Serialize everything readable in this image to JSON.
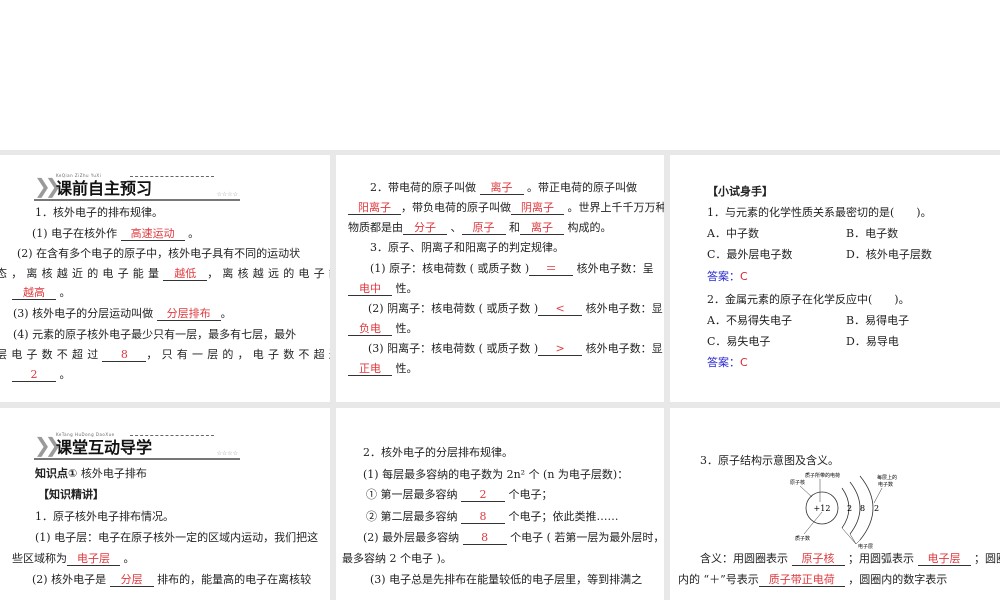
{
  "panels": [
    {
      "header": {
        "pinyin": "KeQian ZiZhu YuXi",
        "title": "课前自主预习",
        "stars": "☆☆☆☆"
      },
      "lines": [
        {
          "segs": [
            "1．核外电子的排布规律。"
          ]
        },
        {
          "segs": [
            "(1) 电子在核外作 ",
            {
              "blank": "高速运动"
            },
            " 。"
          ]
        },
        {
          "segs": [
            "(2) 在含有多个电子的原子中，核外电子具有不同的运动状"
          ]
        },
        {
          "segs": [
            "态，离核越近的电子能量",
            {
              "blank": "越低"
            },
            "，离核越远的电子能量"
          ]
        },
        {
          "segs": [
            {
              "blank": "越高"
            },
            " 。"
          ]
        },
        {
          "segs": [
            "(3) 核外电子的分层运动叫做 ",
            {
              "blank": "分层排布"
            },
            "。"
          ]
        },
        {
          "segs": [
            "(4) 元素的原子核外电子最少只有一层，最多有七层，最外"
          ]
        },
        {
          "segs": [
            "层电子数不超过",
            {
              "blank": "8"
            },
            "，只有一层的，电子数不超过"
          ]
        },
        {
          "segs": [
            {
              "blank": "2"
            },
            " 。"
          ]
        }
      ]
    },
    {
      "lines": [
        {
          "segs": [
            "2．带电荷的原子叫做 ",
            {
              "blank": "离子"
            },
            " 。带正电荷的原子叫做"
          ]
        },
        {
          "segs": [
            {
              "blank": "阳离子"
            },
            "，带负电荷的原子叫做",
            {
              "blank": "阴离子"
            },
            " 。世界上千千万万种"
          ]
        },
        {
          "segs": [
            "物质都是由",
            {
              "blank": "分子"
            },
            " 、",
            {
              "blank": "原子"
            },
            " 和",
            {
              "blank": "离子"
            },
            " 构成的。"
          ]
        },
        {
          "segs": [
            "3．原子、阴离子和阳离子的判定规律。"
          ]
        },
        {
          "segs": [
            "(1) 原子：核电荷数 ( 或质子数 )",
            {
              "blank": "＝"
            },
            " 核外电子数：呈"
          ]
        },
        {
          "segs": [
            {
              "blank": "电中"
            },
            " 性。"
          ]
        },
        {
          "segs": [
            "(2) 阴离子：核电荷数 ( 或质子数 )",
            {
              "blank": "<"
            },
            " 核外电子数：显"
          ]
        },
        {
          "segs": [
            {
              "blank": "负电"
            },
            " 性。"
          ]
        },
        {
          "segs": [
            "(3) 阳离子：核电荷数 ( 或质子数 )",
            {
              "blank": ">"
            },
            " 核外电子数：显"
          ]
        },
        {
          "segs": [
            {
              "blank": "正电"
            },
            " 性。"
          ]
        }
      ]
    },
    {
      "lines": [
        {
          "segs": [
            {
              "bold": "【小试身手】"
            }
          ]
        },
        {
          "segs": [
            "1．与元素的化学性质关系最密切的是(　　)。"
          ]
        },
        {
          "segs": [
            "A．中子数",
            {
              "col2": "B．电子数"
            }
          ]
        },
        {
          "segs": [
            "C．最外层电子数",
            {
              "col2": "D．核外电子层数"
            }
          ]
        },
        {
          "segs": [
            {
              "blue": "答案："
            },
            {
              "red": "C"
            }
          ]
        },
        {
          "segs": [
            "2．金属元素的原子在化学反应中(　　)。"
          ]
        },
        {
          "segs": [
            "A．不易得失电子",
            {
              "col2": "B．易得电子"
            }
          ]
        },
        {
          "segs": [
            "C．易失电子",
            {
              "col2": "D．易导电"
            }
          ]
        },
        {
          "segs": [
            {
              "blue": "答案："
            },
            {
              "red": "C"
            }
          ]
        }
      ]
    },
    {
      "header": {
        "pinyin": "KeTang HuDong DaoXue",
        "title": "课堂互动导学",
        "stars": "☆☆☆☆"
      },
      "lines": [
        {
          "segs": [
            {
              "bold": "知识点①"
            },
            " 核外电子排布"
          ]
        },
        {
          "segs": [
            {
              "bold": "【知识精讲】"
            }
          ]
        },
        {
          "segs": [
            "1．原子核外电子排布情况。"
          ]
        },
        {
          "segs": [
            "(1) 电子层：电子在原子核外一定的区域内运动，我们把这"
          ]
        },
        {
          "segs": [
            "些区域称为",
            {
              "blank": "电子层"
            },
            " 。"
          ]
        },
        {
          "segs": [
            "(2) 核外电子是 ",
            {
              "blank": "分层"
            },
            " 排布的，能量高的电子在离核较"
          ]
        }
      ]
    },
    {
      "lines": [
        {
          "segs": [
            "2．核外电子的分层排布规律。"
          ]
        },
        {
          "segs": [
            "(1) 每层最多容纳的电子数为  2n² 个 (n 为电子层数)："
          ]
        },
        {
          "segs": [
            "① 第一层最多容纳 ",
            {
              "blank": "2"
            },
            " 个电子；"
          ]
        },
        {
          "segs": [
            "② 第二层最多容纳 ",
            {
              "blank": "8"
            },
            " 个电子；依此类推……"
          ]
        },
        {
          "segs": [
            "(2) 最外层最多容纳 ",
            {
              "blank": "8"
            },
            " 个电子 ( 若第一层为最外层时，"
          ]
        },
        {
          "segs": [
            "最多容纳  2 个电子 )。"
          ]
        },
        {
          "segs": [
            "(3) 电子总是先排布在能量较低的电子层里，等到排满之"
          ]
        }
      ]
    },
    {
      "diagram": {
        "nucleus": "+12",
        "shells": [
          "2",
          "8",
          "2"
        ],
        "label_nucleus": "原子核",
        "label_charge": "质子所带的电荷",
        "label_per_shell_1": "每层上的",
        "label_per_shell_2": "电子数",
        "label_protons": "质子数",
        "label_shell": "电子层"
      },
      "lines": [
        {
          "segs": [
            "3．原子结构示意图及含义。"
          ]
        },
        {
          "segs": [
            "含义：用圆圈表示 ",
            {
              "blank": "原子核"
            },
            " ；用圆弧表示 ",
            {
              "blank": "电子层"
            },
            " ；圆圈"
          ]
        },
        {
          "segs": [
            "内的 “＋”号表示",
            {
              "blank": "质子带正电荷"
            },
            " ，圆圈内的数字表示"
          ]
        }
      ]
    }
  ]
}
